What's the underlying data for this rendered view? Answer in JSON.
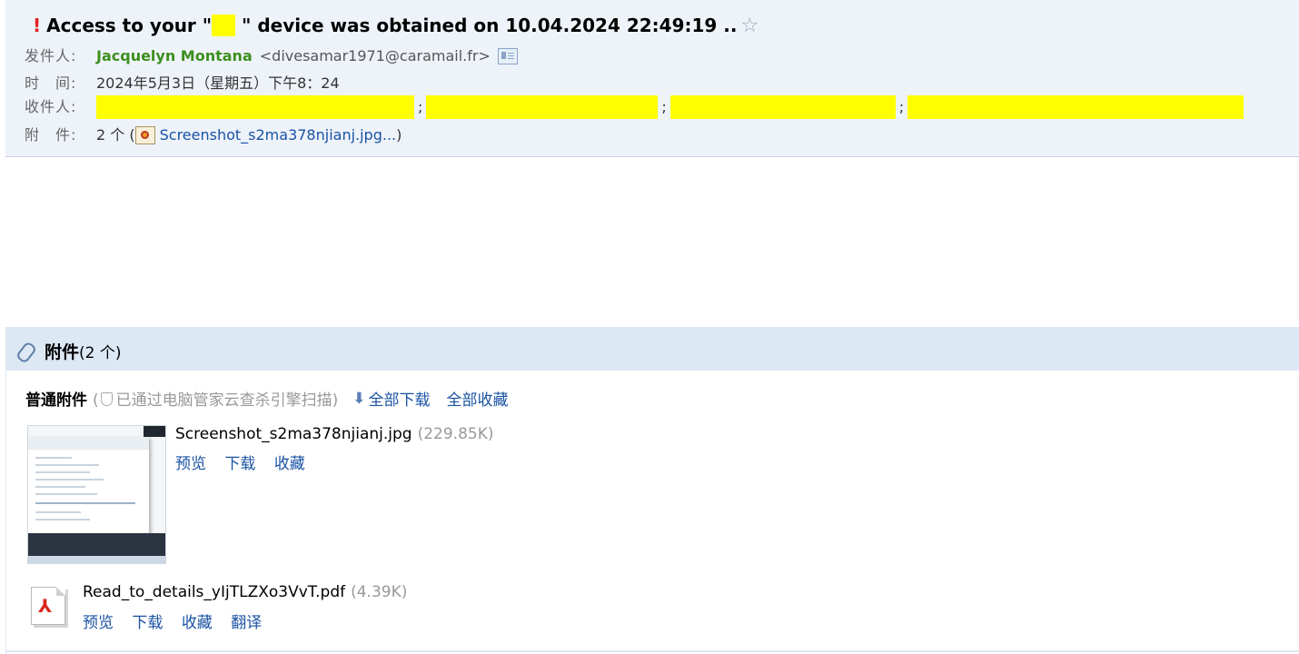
{
  "email": {
    "subject_prefix": "Access to your \"",
    "subject_redacted": "xx",
    "subject_suffix": " \" device was obtained on 10.04.2024 22:49:19 ..",
    "from_label": "发件人:",
    "from_name": "Jacquelyn Montana",
    "from_email": "<divesamar1971@caramail.fr>",
    "time_label": "时　间:",
    "time_value": "2024年5月3日（星期五）下午8：24",
    "to_label": "收件人:",
    "recipient_sep": ";",
    "attachments_label": "附　件:",
    "attachments_count": "2 个 (",
    "attachments_first": "Screenshot_s2ma378njianj.jpg...",
    "attachments_close": ")"
  },
  "attachments": {
    "title": "附件",
    "count": "(2 个)",
    "normal_label": "普通附件",
    "scan_open": "(",
    "scan_note": "已通过电脑管家云查杀引擎扫描)",
    "download_all": "全部下载",
    "collect_all": "全部收藏",
    "files": [
      {
        "name": "Screenshot_s2ma378njianj.jpg",
        "size": "(229.85K)",
        "actions": [
          "预览",
          "下载",
          "收藏"
        ]
      },
      {
        "name": "Read_to_details_yIjTLZXo3VvT.pdf",
        "size": "(4.39K)",
        "actions": [
          "预览",
          "下载",
          "收藏",
          "翻译"
        ]
      }
    ]
  },
  "colors": {
    "sender_name": "#3d8f1e",
    "link": "#1a52a3",
    "redaction": "#ffff00",
    "important": "#e02020",
    "header_bg": "#eef3fa",
    "attach_bar_bg": "#dde8f5"
  },
  "icons": [
    "important-icon",
    "star-icon",
    "contact-card-icon",
    "image-file-icon",
    "paperclip-icon",
    "shield-icon",
    "download-icon",
    "pdf-file-icon"
  ]
}
